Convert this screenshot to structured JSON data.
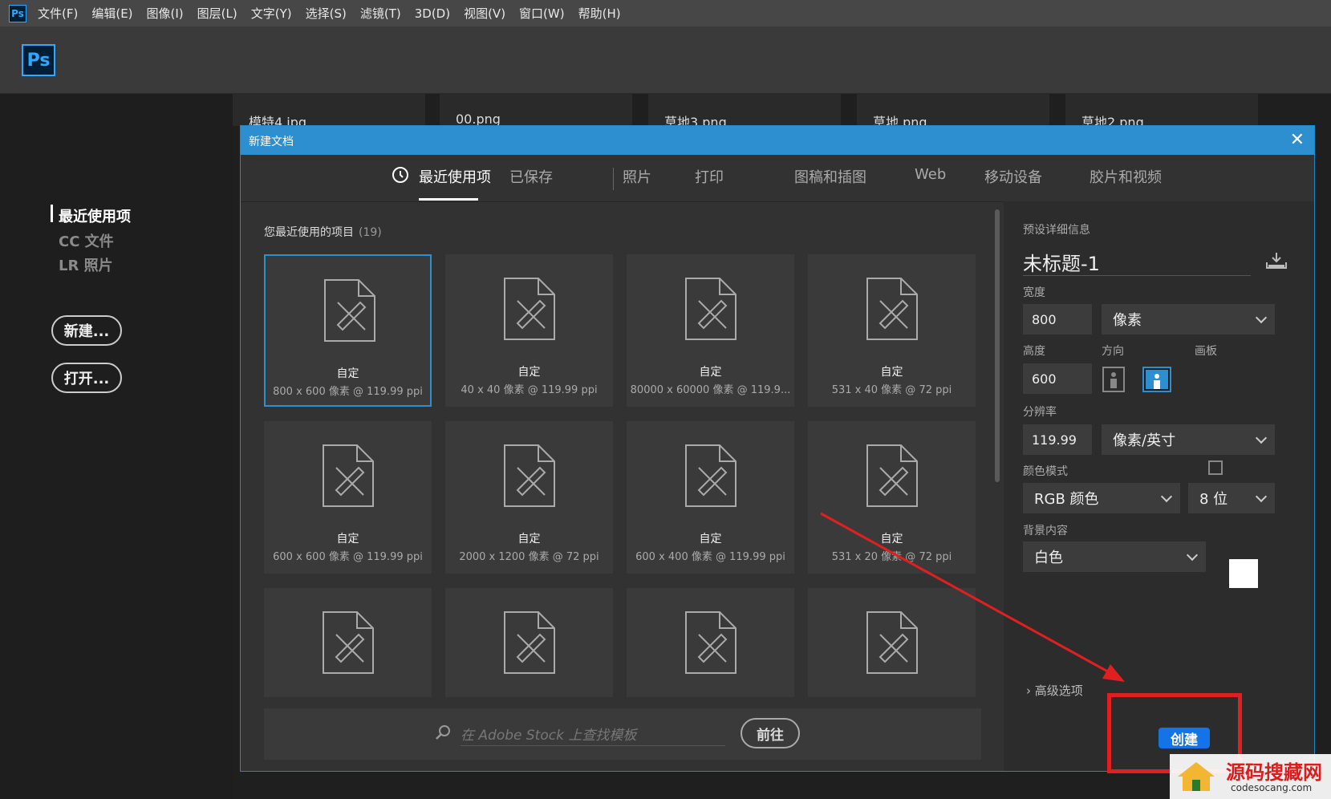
{
  "menubar": {
    "app_icon": "Ps",
    "items": [
      "文件(F)",
      "编辑(E)",
      "图像(I)",
      "图层(L)",
      "文字(Y)",
      "选择(S)",
      "滤镜(T)",
      "3D(D)",
      "视图(V)",
      "窗口(W)",
      "帮助(H)"
    ]
  },
  "toolbar": {
    "logo": "Ps"
  },
  "leftnav": {
    "items": [
      "最近使用项",
      "CC 文件",
      "LR 照片"
    ],
    "new_button": "新建...",
    "open_button": "打开..."
  },
  "background_files": [
    "模特4.jpg",
    "00.png",
    "草地3.png",
    "草地.png",
    "草地2.png"
  ],
  "dialog": {
    "title": "新建文档",
    "tabs": [
      "最近使用项",
      "已保存",
      "照片",
      "打印",
      "图稿和插图",
      "Web",
      "移动设备",
      "胶片和视频"
    ],
    "recent_heading": "您最近使用的项目",
    "recent_count": "(19)",
    "cards": [
      {
        "name": "自定",
        "size": "800 x 600 像素 @ 119.99 ppi"
      },
      {
        "name": "自定",
        "size": "40 x 40 像素 @ 119.99 ppi"
      },
      {
        "name": "自定",
        "size": "80000 x 60000 像素 @ 119.9..."
      },
      {
        "name": "自定",
        "size": "531 x 40 像素 @ 72 ppi"
      },
      {
        "name": "自定",
        "size": "600 x 600 像素 @ 119.99 ppi"
      },
      {
        "name": "自定",
        "size": "2000 x 1200 像素 @ 72 ppi"
      },
      {
        "name": "自定",
        "size": "600 x 400 像素 @ 119.99 ppi"
      },
      {
        "name": "自定",
        "size": "531 x 20 像素 @ 72 ppi"
      },
      {
        "name": "",
        "size": ""
      },
      {
        "name": "",
        "size": ""
      },
      {
        "name": "",
        "size": ""
      },
      {
        "name": "",
        "size": ""
      }
    ],
    "stock_placeholder": "在 Adobe Stock 上查找模板",
    "go_button": "前往"
  },
  "preset": {
    "heading": "预设详细信息",
    "doc_name": "未标题-1",
    "width_label": "宽度",
    "width_value": "800",
    "width_unit": "像素",
    "height_label": "高度",
    "height_value": "600",
    "orientation_label": "方向",
    "artboard_label": "画板",
    "resolution_label": "分辨率",
    "resolution_value": "119.99",
    "resolution_unit": "像素/英寸",
    "color_mode_label": "颜色模式",
    "color_mode_value": "RGB 颜色",
    "bit_depth_value": "8 位",
    "background_label": "背景内容",
    "background_value": "白色",
    "background_color": "#ffffff",
    "advanced_label": "高级选项",
    "create_button": "创建"
  },
  "watermark": {
    "title": "源码搜藏网",
    "url": "codesocang.com"
  },
  "colors": {
    "accent": "#2d8ed0",
    "button_blue": "#1473e6",
    "annotation_red": "#e02020"
  }
}
